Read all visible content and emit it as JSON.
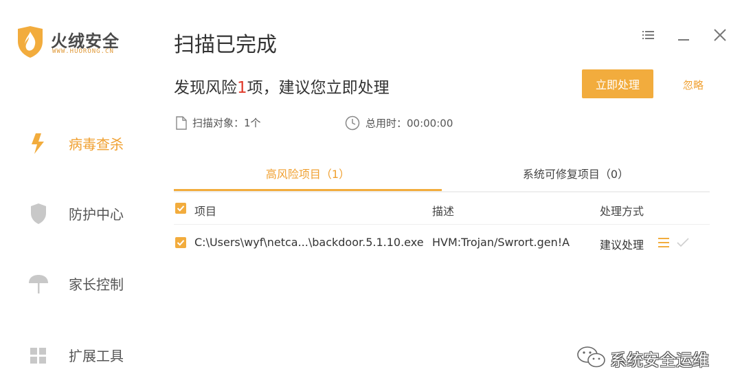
{
  "app": {
    "name": "火绒安全",
    "url": "WWW.HUORONG.CN"
  },
  "sidebar": {
    "items": [
      {
        "label": "病毒查杀",
        "icon": "lightning-icon",
        "active": true
      },
      {
        "label": "防护中心",
        "icon": "shield-icon",
        "active": false
      },
      {
        "label": "家长控制",
        "icon": "umbrella-icon",
        "active": false
      },
      {
        "label": "扩展工具",
        "icon": "grid-icon",
        "active": false
      }
    ]
  },
  "window_controls": {
    "menu_icon": "menu-icon",
    "minimize_icon": "minimize-icon",
    "close_icon": "close-icon"
  },
  "header": {
    "title": "扫描已完成",
    "summary_prefix": "发现风险",
    "summary_count": "1",
    "summary_suffix": "项，建议您立即处理",
    "primary_button": "立即处理",
    "ignore_link": "忽略"
  },
  "meta": {
    "scan_target": "扫描对象：1个",
    "duration": "总用时：00:00:00"
  },
  "tabs": [
    {
      "label": "高风险项目（1）",
      "active": true
    },
    {
      "label": "系统可修复项目（0）",
      "active": false
    }
  ],
  "table": {
    "columns": [
      "项目",
      "描述",
      "处理方式"
    ],
    "rows": [
      {
        "checked": true,
        "item": "C:\\Users\\wyf\\netca...\\backdoor.5.1.10.exe",
        "description": "HVM:Trojan/Swrort.gen!A",
        "action": "建议处理"
      }
    ]
  },
  "watermark": {
    "text": "系统安全运维"
  },
  "colors": {
    "accent": "#f2ac3d",
    "accent_text": "#f0a030",
    "danger": "#e03a2a",
    "text": "#333333"
  }
}
